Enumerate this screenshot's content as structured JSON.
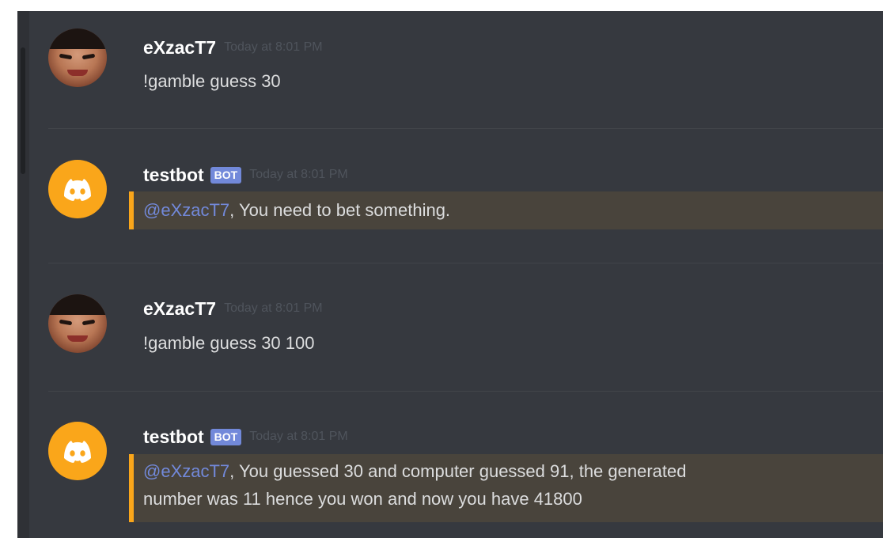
{
  "messages": [
    {
      "author": "eXzacT7",
      "timestamp": "Today at 8:01 PM",
      "text": "!gamble guess 30",
      "avatar": "user-face-avatar"
    },
    {
      "author": "testbot",
      "badge": "BOT",
      "timestamp": "Today at 8:01 PM",
      "mention": "@eXzacT7",
      "text": ", You need to bet something.",
      "avatar": "discord-bot-avatar",
      "highlight_color": "#faa61a"
    },
    {
      "author": "eXzacT7",
      "timestamp": "Today at 8:01 PM",
      "text": "!gamble guess 30 100",
      "avatar": "user-face-avatar"
    },
    {
      "author": "testbot",
      "badge": "BOT",
      "timestamp": "Today at 8:01 PM",
      "mention": "@eXzacT7",
      "text_line1": ", You guessed 30 and computer guessed 91, the generated",
      "text_line2": "number was 11 hence you won and now you have 41800",
      "avatar": "discord-bot-avatar",
      "highlight_color": "#faa61a"
    }
  ],
  "colors": {
    "background": "#36393f",
    "mention": "#7289da",
    "bot_badge": "#7289da",
    "highlight_bar": "#faa61a"
  }
}
